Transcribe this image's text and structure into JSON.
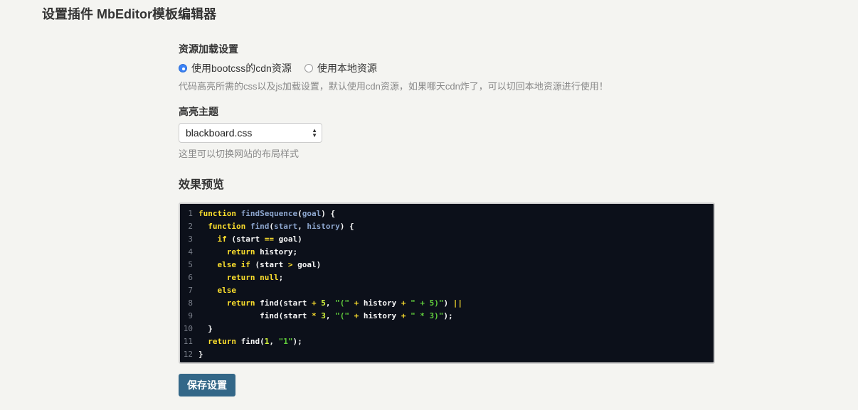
{
  "page": {
    "title": "设置插件 MbEditor模板编辑器"
  },
  "resource": {
    "label": "资源加载设置",
    "options": [
      {
        "label": "使用bootcss的cdn资源",
        "checked": true
      },
      {
        "label": "使用本地资源",
        "checked": false
      }
    ],
    "help": "代码高亮所需的css以及js加载设置，默认使用cdn资源，如果哪天cdn炸了，可以切回本地资源进行使用！"
  },
  "theme": {
    "label": "高亮主题",
    "selected": "blackboard.css",
    "help": "这里可以切换网站的布局样式"
  },
  "preview": {
    "title": "效果预览",
    "lines": [
      [
        [
          "k",
          "function"
        ],
        [
          "c",
          " "
        ],
        [
          "f",
          "findSequence"
        ],
        [
          "c",
          "("
        ],
        [
          "f",
          "goal"
        ],
        [
          "c",
          ") {"
        ]
      ],
      [
        [
          "c",
          "  "
        ],
        [
          "k",
          "function"
        ],
        [
          "c",
          " "
        ],
        [
          "f",
          "find"
        ],
        [
          "c",
          "("
        ],
        [
          "f",
          "start"
        ],
        [
          "c",
          ", "
        ],
        [
          "f",
          "history"
        ],
        [
          "c",
          ") {"
        ]
      ],
      [
        [
          "c",
          "    "
        ],
        [
          "k",
          "if"
        ],
        [
          "c",
          " (start "
        ],
        [
          "o",
          "=="
        ],
        [
          "c",
          " goal)"
        ]
      ],
      [
        [
          "c",
          "      "
        ],
        [
          "k",
          "return"
        ],
        [
          "c",
          " history;"
        ]
      ],
      [
        [
          "c",
          "    "
        ],
        [
          "k",
          "else if"
        ],
        [
          "c",
          " (start "
        ],
        [
          "o",
          ">"
        ],
        [
          "c",
          " goal)"
        ]
      ],
      [
        [
          "c",
          "      "
        ],
        [
          "k",
          "return"
        ],
        [
          "c",
          " "
        ],
        [
          "k",
          "null"
        ],
        [
          "c",
          ";"
        ]
      ],
      [
        [
          "c",
          "    "
        ],
        [
          "k",
          "else"
        ]
      ],
      [
        [
          "c",
          "      "
        ],
        [
          "k",
          "return"
        ],
        [
          "c",
          " find(start "
        ],
        [
          "o",
          "+"
        ],
        [
          "c",
          " "
        ],
        [
          "n",
          "5"
        ],
        [
          "c",
          ", "
        ],
        [
          "s",
          "\"(\""
        ],
        [
          "c",
          " "
        ],
        [
          "o",
          "+"
        ],
        [
          "c",
          " history "
        ],
        [
          "o",
          "+"
        ],
        [
          "c",
          " "
        ],
        [
          "s",
          "\" + 5)\""
        ],
        [
          "c",
          ") "
        ],
        [
          "o",
          "||"
        ]
      ],
      [
        [
          "c",
          "             find(start "
        ],
        [
          "o",
          "*"
        ],
        [
          "c",
          " "
        ],
        [
          "n",
          "3"
        ],
        [
          "c",
          ", "
        ],
        [
          "s",
          "\"(\""
        ],
        [
          "c",
          " "
        ],
        [
          "o",
          "+"
        ],
        [
          "c",
          " history "
        ],
        [
          "o",
          "+"
        ],
        [
          "c",
          " "
        ],
        [
          "s",
          "\" * 3)\""
        ],
        [
          "c",
          ");"
        ]
      ],
      [
        [
          "c",
          "  }"
        ]
      ],
      [
        [
          "c",
          "  "
        ],
        [
          "k",
          "return"
        ],
        [
          "c",
          " find("
        ],
        [
          "n",
          "1"
        ],
        [
          "c",
          ", "
        ],
        [
          "s",
          "\"1\""
        ],
        [
          "c",
          ");"
        ]
      ],
      [
        [
          "c",
          "}"
        ]
      ]
    ]
  },
  "actions": {
    "save_label": "保存设置"
  }
}
